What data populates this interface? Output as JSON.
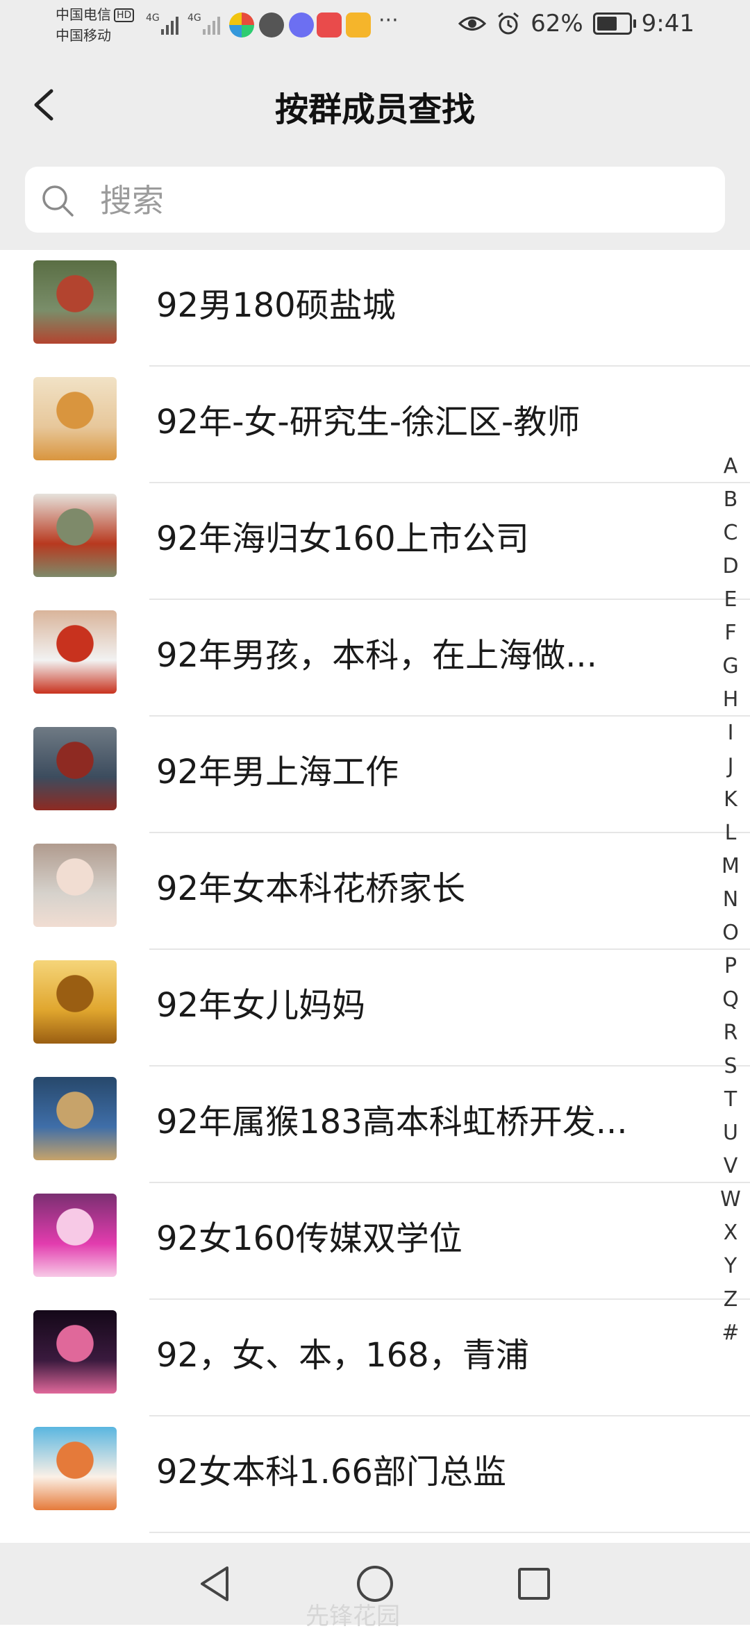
{
  "status_bar": {
    "carrier_1": "中国电信",
    "carrier_1_badge": "HD",
    "carrier_2": "中国移动",
    "signal_1": "4G",
    "signal_2": "4G",
    "more": "···",
    "battery": "62%",
    "time": "9:41",
    "icons": [
      "eye-icon",
      "alarm-icon",
      "battery-icon"
    ]
  },
  "header": {
    "title": "按群成员查找",
    "back_icon": "chevron-left-icon"
  },
  "search": {
    "placeholder": "搜索",
    "value": "",
    "icon": "search-icon"
  },
  "members": [
    {
      "name": "92男180硕盐城",
      "avatar_colors": [
        "#7a8e6a",
        "#b3442f",
        "#5a6e44"
      ]
    },
    {
      "name": "92年-女-研究生-徐汇区-教师",
      "avatar_colors": [
        "#e7c79a",
        "#d9953e",
        "#f1e2c6"
      ]
    },
    {
      "name": "92年海归女160上市公司",
      "avatar_colors": [
        "#b8391f",
        "#7e8a6a",
        "#e6e2dc"
      ]
    },
    {
      "name": "92年男孩，本科，在上海做...",
      "avatar_colors": [
        "#f2f2f2",
        "#c8321e",
        "#d9b49a"
      ]
    },
    {
      "name": "92年男上海工作",
      "avatar_colors": [
        "#3c4c5e",
        "#8e2a22",
        "#6f7a84"
      ]
    },
    {
      "name": "92年女本科花桥家长",
      "avatar_colors": [
        "#d6d2cc",
        "#f1ddd2",
        "#b09b8e"
      ]
    },
    {
      "name": "92年女儿妈妈",
      "avatar_colors": [
        "#e0a62e",
        "#9a5e12",
        "#f5d57a"
      ]
    },
    {
      "name": "92年属猴183高本科虹桥开发...",
      "avatar_colors": [
        "#3f6ea8",
        "#c7a36a",
        "#27486b"
      ]
    },
    {
      "name": "92女160传媒双学位",
      "avatar_colors": [
        "#e23cae",
        "#f7c9e6",
        "#7a2f71"
      ]
    },
    {
      "name": "92，女、本，168，青浦",
      "avatar_colors": [
        "#3a1a3e",
        "#e0689a",
        "#140818"
      ]
    },
    {
      "name": "92女本科1.66部门总监",
      "avatar_colors": [
        "#fbf0e6",
        "#e57a3a",
        "#5ab6e0"
      ]
    }
  ],
  "index_letters": [
    "A",
    "B",
    "C",
    "D",
    "E",
    "F",
    "G",
    "H",
    "I",
    "J",
    "K",
    "L",
    "M",
    "N",
    "O",
    "P",
    "Q",
    "R",
    "S",
    "T",
    "U",
    "V",
    "W",
    "X",
    "Y",
    "Z",
    "#"
  ],
  "nav_bar": {
    "back": "triangle-back-icon",
    "home": "circle-home-icon",
    "recent": "square-recent-icon"
  },
  "watermark": "先锋花园"
}
